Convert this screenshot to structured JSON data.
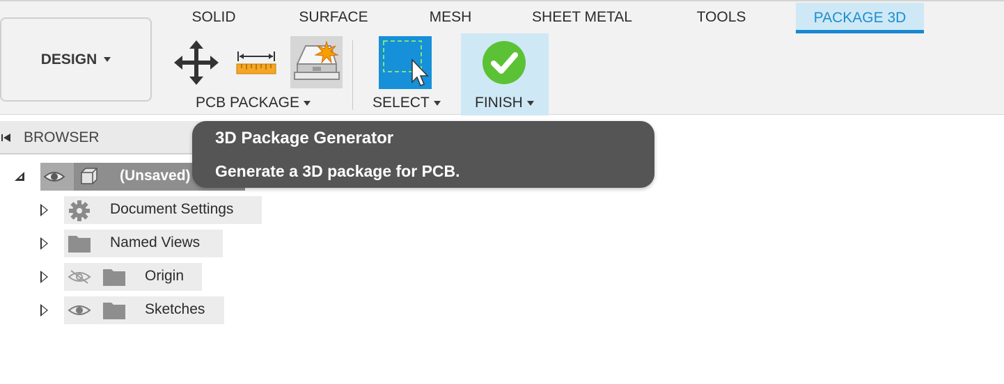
{
  "workspace": {
    "label": "DESIGN"
  },
  "tabs": [
    {
      "label": "SOLID",
      "active": false
    },
    {
      "label": "SURFACE",
      "active": false
    },
    {
      "label": "MESH",
      "active": false
    },
    {
      "label": "SHEET METAL",
      "active": false
    },
    {
      "label": "TOOLS",
      "active": false
    },
    {
      "label": "PACKAGE 3D",
      "active": true
    }
  ],
  "groups": {
    "pcb_package": {
      "label": "PCB PACKAGE",
      "tools": [
        "move-icon",
        "measure-icon",
        "package-generator-icon"
      ]
    },
    "select": {
      "label": "SELECT",
      "tools": [
        "select-icon"
      ]
    },
    "finish": {
      "label": "FINISH",
      "tools": [
        "finish-check-icon"
      ]
    }
  },
  "browser": {
    "title": "BROWSER",
    "root": {
      "label": "(Unsaved)",
      "visible": true
    },
    "items": [
      {
        "label": "Document Settings",
        "icon": "gear-icon"
      },
      {
        "label": "Named Views",
        "icon": "folder-icon"
      },
      {
        "label": "Origin",
        "icon": "folder-icon",
        "visible": false
      },
      {
        "label": "Sketches",
        "icon": "folder-icon",
        "visible": true
      }
    ]
  },
  "tooltip": {
    "title": "3D Package Generator",
    "description": "Generate a 3D package for PCB."
  },
  "colors": {
    "accent": "#1789ce",
    "active_tab_bg": "#cfe8f5",
    "finish_green": "#5bc236",
    "select_blue": "#1690d8",
    "tooltip_bg": "#555555"
  }
}
